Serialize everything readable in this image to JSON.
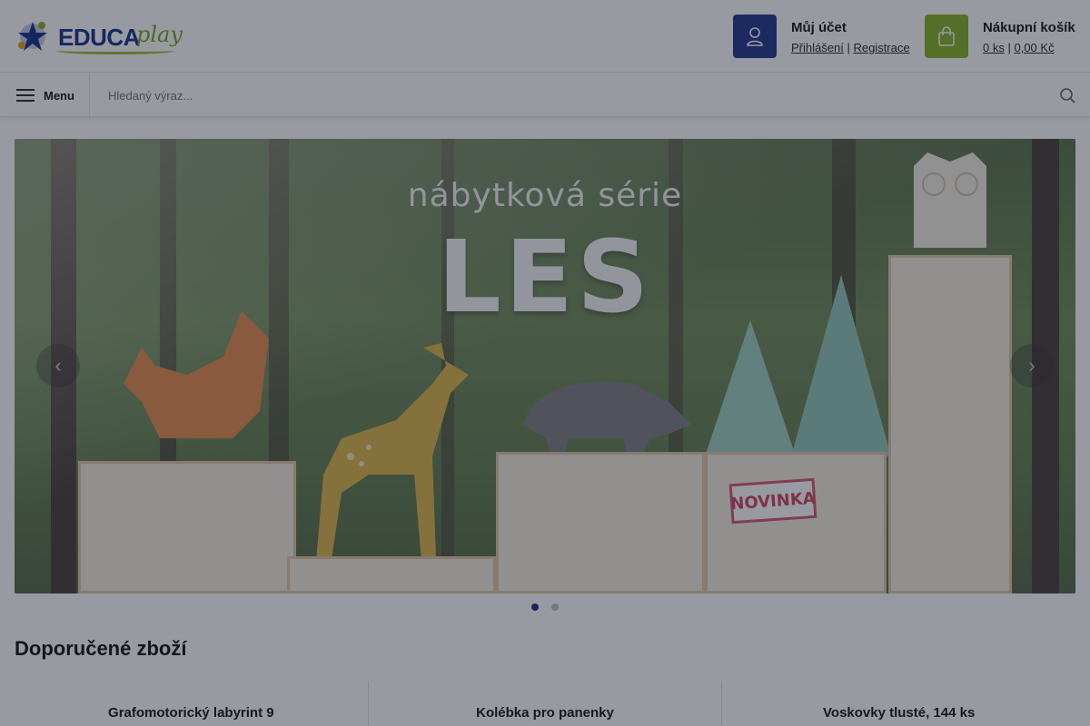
{
  "header": {
    "logo": {
      "brand": "EDUCA",
      "suffix": "play"
    },
    "account": {
      "title": "Můj účet",
      "login": "Přihlášení",
      "separator": "|",
      "register": "Registrace"
    },
    "cart": {
      "title": "Nákupní košík",
      "count": "0 ks",
      "separator": "|",
      "total": "0,00 Kč"
    }
  },
  "navbar": {
    "menu_label": "Menu",
    "search_placeholder": "Hledaný výraz..."
  },
  "banner": {
    "subtitle": "nábytková série",
    "title": "LES",
    "badge": "NOVINKA",
    "prev_arrow": "‹",
    "next_arrow": "›",
    "slides_total": 2,
    "slide_active": 1
  },
  "recommended": {
    "title": "Doporučené zboží",
    "products": [
      {
        "name": "Grafomotorický labyrint 9"
      },
      {
        "name": "Kolébka pro panenky"
      },
      {
        "name": "Voskovky tlusté, 144 ks"
      }
    ]
  },
  "colors": {
    "account_bg": "#2b3f8f",
    "cart_bg": "#8ab52e",
    "active_dot": "#1d3a8f"
  },
  "icons": {
    "account": "user-icon",
    "cart": "shopping-bag-icon",
    "menu": "hamburger-icon",
    "search": "search-icon"
  }
}
